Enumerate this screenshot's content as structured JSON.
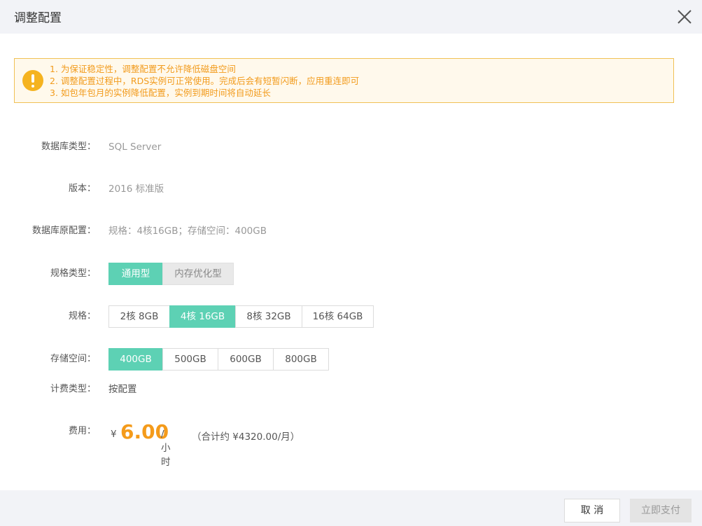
{
  "dialog": {
    "title": "调整配置"
  },
  "alert": {
    "icon": "warning-icon",
    "lines": [
      "1. 为保证稳定性，调整配置不允许降低磁盘空间",
      "2. 调整配置过程中，RDS实例可正常使用。完成后会有短暂闪断，应用重连即可",
      "3. 如包年包月的实例降低配置，实例到期时间将自动延长"
    ]
  },
  "fields": {
    "db_type": {
      "label": "数据库类型：",
      "value": "SQL Server"
    },
    "version": {
      "label": "版本：",
      "value": "2016 标准版"
    },
    "orig_config": {
      "label": "数据库原配置：",
      "value": "规格：4核16GB；存储空间：400GB"
    },
    "spec_type": {
      "label": "规格类型：",
      "options": [
        "通用型",
        "内存优化型"
      ],
      "selected": "通用型"
    },
    "spec": {
      "label": "规格：",
      "options": [
        "2核 8GB",
        "4核 16GB",
        "8核 32GB",
        "16核 64GB"
      ],
      "selected": "4核 16GB"
    },
    "storage": {
      "label": "存储空间：",
      "options": [
        "400GB",
        "500GB",
        "600GB",
        "800GB"
      ],
      "selected": "400GB"
    },
    "billing": {
      "label": "计费类型：",
      "value": "按配置"
    },
    "fee": {
      "label": "费用：",
      "currency": "¥",
      "amount": "6.00",
      "unit": "/小时",
      "total": "（合计约 ¥4320.00/月）"
    }
  },
  "footer": {
    "cancel_label": "取 消",
    "pay_label": "立即支付"
  },
  "colors": {
    "accent": "#5dd1b4",
    "warning": "#f5b320",
    "price": "#f49b1b"
  }
}
